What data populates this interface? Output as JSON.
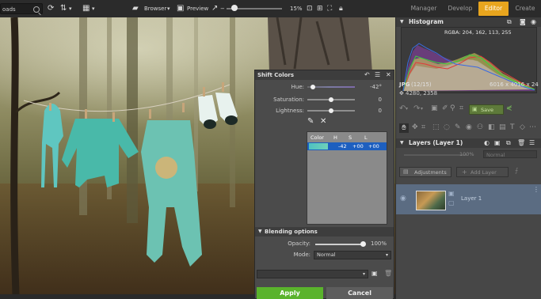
{
  "toolbar": {
    "path_text": "oads",
    "browser_label": "Browser",
    "preview_label": "Preview",
    "zoom_value": "15%",
    "modes": [
      "Manager",
      "Develop",
      "Editor",
      "Create"
    ],
    "active_mode": "Editor"
  },
  "dialog": {
    "title": "Shift Colors",
    "hue_label": "Hue:",
    "hue_value": "-42°",
    "saturation_label": "Saturation:",
    "saturation_value": "0",
    "lightness_label": "Lightness:",
    "lightness_value": "0",
    "table": {
      "headers": [
        "Color",
        "H",
        "S",
        "L"
      ],
      "rows": [
        {
          "h": "-42",
          "s": "+00",
          "l": "+00"
        }
      ]
    },
    "blending_title": "Blending options",
    "opacity_label": "Opacity:",
    "opacity_value": "100%",
    "mode_label": "Mode:",
    "mode_value": "Normal",
    "apply_label": "Apply",
    "cancel_label": "Cancel"
  },
  "panel": {
    "histogram_title": "Histogram",
    "rgba_text": "RGBA: 204, 162, 113, 255",
    "file_type": "JPG",
    "file_index": "(12/15)",
    "dimensions": "6016 x 4016 x 24",
    "coords": "4280, 2358",
    "save_label": "Save",
    "layers_title": "Layers (Layer 1)",
    "layer_opacity": "100%",
    "layer_mode": "Normal",
    "adjustments_label": "Adjustments",
    "add_layer_label": "Add Layer",
    "layer_name": "Layer 1"
  },
  "colors": {
    "accent": "#e8a51e",
    "apply_green": "#5ab32c",
    "selection_blue": "#1d5fbf",
    "layer_selected": "#5b6c82"
  }
}
